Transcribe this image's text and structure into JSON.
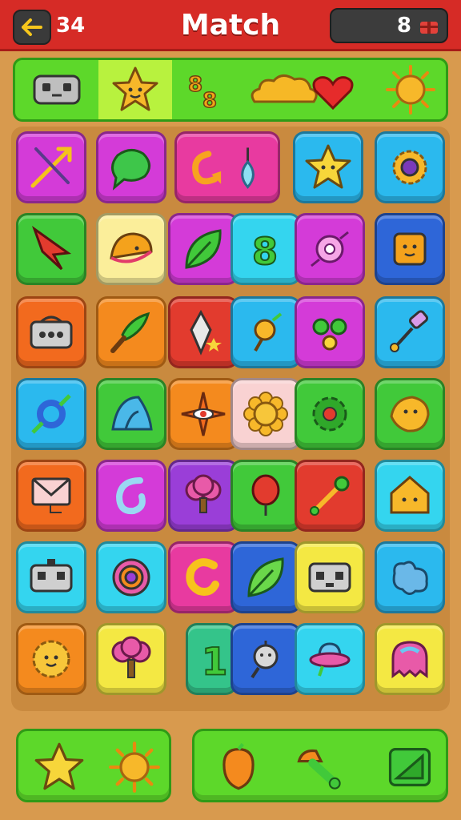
{
  "header": {
    "level": "34",
    "title": "Match",
    "score": "8",
    "back_icon": "arrow-left-icon",
    "score_icon": "gift-icon"
  },
  "colors": {
    "header_red": "#d62b26",
    "board_bg": "#c98a3f",
    "goal_green": "#5dd82a",
    "magenta": "#d43bd8",
    "pink": "#e83aa0",
    "sky": "#2bb9ee",
    "green": "#41c93a",
    "yellow": "#f4e843",
    "orange": "#f48a1e",
    "red": "#e23b2e",
    "cyan": "#34d5ef",
    "blue": "#2e66d8",
    "purple": "#9a3ed8",
    "peach": "#f9d2d2",
    "paleyellow": "#fbee9a"
  },
  "goals": [
    "robot-icon",
    "star-face-icon",
    "music-notes-icon",
    "cloud-heart-icon",
    "sun-icon"
  ],
  "board": {
    "rows": [
      [
        "arrows-icon",
        "speech-bubble-icon",
        "hook-drop-icon",
        "star-face-icon",
        "gear-sun-icon"
      ],
      [
        "cursor-arrow-icon",
        "taco-face-icon",
        "leaf-icon",
        "number-8-icon",
        "candy-icon",
        "box-face-icon"
      ],
      [
        "radio-icon",
        "brush-icon",
        "crystal-icon",
        "fruit-icon",
        "frog-face-icon",
        "wand-icon"
      ],
      [
        "candy-ring-icon",
        "shark-fin-icon",
        "eye-star-icon",
        "flower-face-icon",
        "gear-icon",
        "lemon-face-icon"
      ],
      [
        "envelope-icon",
        "swirl-icon",
        "tree-icon",
        "balloon-icon",
        "wrench-icon",
        "house-face-icon"
      ],
      [
        "robot-icon",
        "spiral-icon",
        "letter-c-icon",
        "leaf-icon",
        "cassette-icon",
        "cloud-blob-icon"
      ],
      [
        "sun-face-icon",
        "tree-icon",
        "number-1-icon",
        "lamp-face-icon",
        "ufo-icon",
        "ghost-icon"
      ]
    ]
  },
  "trays": {
    "left": [
      "star-icon",
      "sun-icon"
    ],
    "right": [
      "acorn-icon",
      "mushroom-icon",
      "triangle-card-icon"
    ]
  }
}
